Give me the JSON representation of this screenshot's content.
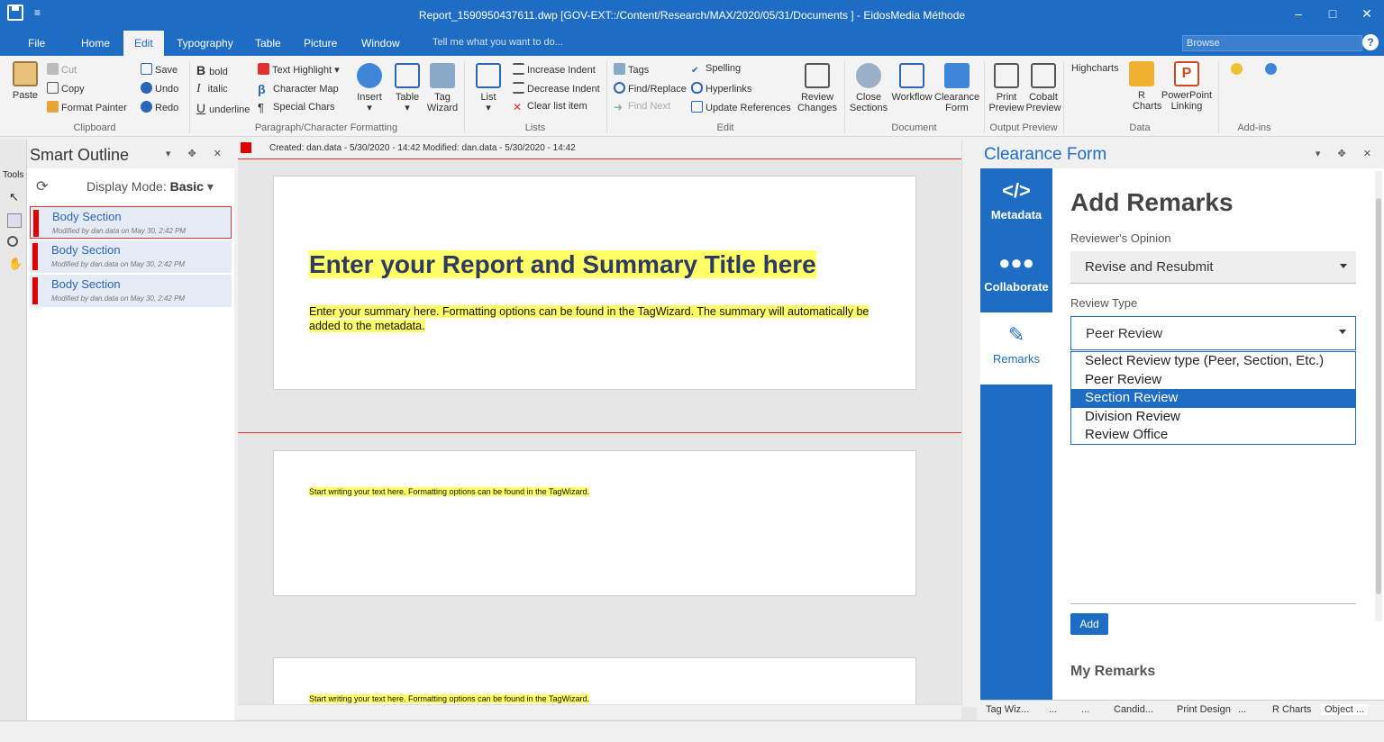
{
  "titlebar": {
    "title": "Report_1590950437611.dwp  [GOV-EXT::/Content/Research/MAX/2020/05/31/Documents ] - EidosMedia Méthode",
    "qat": "≡",
    "minimize": "–",
    "maximize": "□",
    "close": "✕"
  },
  "menu": {
    "tabs": [
      "File",
      "Home",
      "Edit",
      "Typography",
      "Table",
      "Picture",
      "Window"
    ],
    "active": "Edit",
    "tell": "Tell me what you want to do...",
    "browse": "Browse",
    "help": "?"
  },
  "ribbon": {
    "clipboard": {
      "paste": "Paste",
      "cut": "Cut",
      "copy": "Copy",
      "format_painter": "Format Painter",
      "label": "Clipboard"
    },
    "edit_basic": {
      "save": "Save",
      "undo": "Undo",
      "redo": "Redo"
    },
    "formatting": {
      "bold": "bold",
      "italic": "italic",
      "underline": "underline",
      "text_highlight": "Text Highlight",
      "character_map": "Character Map",
      "special_chars": "Special Chars",
      "insert": "Insert",
      "table": "Table",
      "tag_wizard": "Tag Wizard",
      "label": "Paragraph/Character Formatting"
    },
    "lists": {
      "list": "List",
      "increase_indent": "Increase Indent",
      "decrease_indent": "Decrease Indent",
      "clear_list_item": "Clear list item",
      "label": "Lists"
    },
    "edit": {
      "tags": "Tags",
      "find_replace": "Find/Replace",
      "find_next": "Find Next",
      "spelling": "Spelling",
      "hyperlinks": "Hyperlinks",
      "update_references": "Update References",
      "review_changes": "Review Changes",
      "label": "Edit"
    },
    "document": {
      "close_sections": "Close Sections",
      "workflow": "Workflow",
      "clearance_form": "Clearance Form",
      "label": "Document"
    },
    "output": {
      "print_preview": "Print Preview",
      "cobalt_preview": "Cobalt Preview",
      "label": "Output Preview"
    },
    "data": {
      "highcharts": "Highcharts",
      "r_charts": "R Charts",
      "powerpoint_linking": "PowerPoint Linking",
      "label": "Data"
    },
    "addins": {
      "label": "Add-ins"
    }
  },
  "outline": {
    "title": "Smart Outline",
    "tools": "Tools",
    "display_mode_label": "Display Mode:",
    "display_mode_value": "Basic",
    "sections": [
      {
        "name": "Body Section",
        "meta": "Modified by dan.data on May 30, 2:42 PM"
      },
      {
        "name": "Body Section",
        "meta": "Modified by dan.data on May 30, 2:42 PM"
      },
      {
        "name": "Body Section",
        "meta": "Modified by dan.data on May 30, 2:42 PM"
      }
    ]
  },
  "document": {
    "header": "Created: dan.data - 5/30/2020 - 14:42   Modified: dan.data - 5/30/2020 - 14:42",
    "title": "Enter your Report and Summary Title here",
    "summary": "Enter your summary here. Formatting options can be found in the TagWizard. The summary will automatically be added to the metadata.",
    "body1": "Start writing your text here. Formatting options can be found in the TagWizard.",
    "body2": "Start writing your text here. Formatting options can be found in the TagWizard."
  },
  "clearance": {
    "title": "Clearance Form",
    "nav": [
      "Metadata",
      "Collaborate",
      "Remarks"
    ],
    "heading": "Add Remarks",
    "opinion_label": "Reviewer's Opinion",
    "opinion_value": "Revise and Resubmit",
    "review_type_label": "Review Type",
    "review_type_value": "Peer Review",
    "options": [
      "Select Review type (Peer, Section, Etc.)",
      "Peer Review",
      "Section Review",
      "Division Review",
      "Review Office"
    ],
    "highlighted_option": "Section Review",
    "add": "Add",
    "my_remarks": "My Remarks"
  },
  "bottom_tabs": [
    "Tag Wiz...",
    "...",
    "...",
    "Candid...",
    "Print Design",
    "...",
    "R Charts",
    "Object ..."
  ],
  "colors": {
    "accent": "#1e6cc4",
    "section_marker": "#e00000",
    "highlight": "#ffff66"
  }
}
